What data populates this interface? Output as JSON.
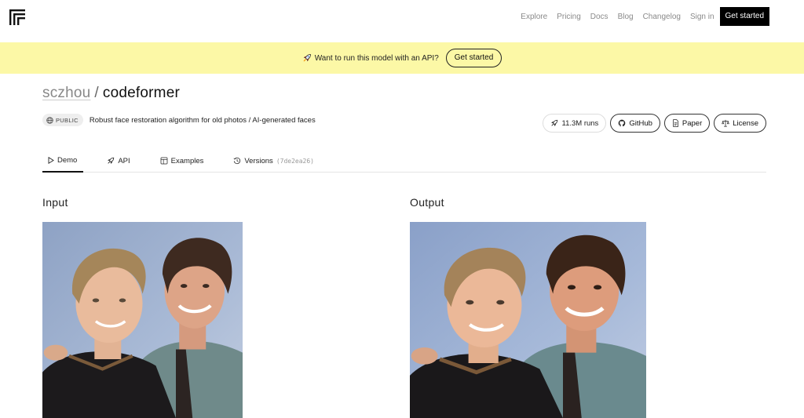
{
  "nav": {
    "logo_icon": "replicate-logo-icon",
    "links": [
      "Explore",
      "Pricing",
      "Docs",
      "Blog",
      "Changelog",
      "Sign in"
    ],
    "cta": "Get started"
  },
  "banner": {
    "icon": "rocket-icon",
    "text": "Want to run this model with an API?",
    "button": "Get started",
    "background": "#fcf8a6"
  },
  "model": {
    "owner": "sczhou",
    "separator": "/",
    "name": "codeformer",
    "visibility": "PUBLIC",
    "description": "Robust face restoration algorithm for old photos / AI-generated faces",
    "runs": "11.3M runs",
    "links": {
      "github": "GitHub",
      "paper": "Paper",
      "license": "License"
    }
  },
  "tabs": [
    {
      "label": "Demo",
      "icon": "play-icon",
      "active": true
    },
    {
      "label": "API",
      "icon": "rocket-icon",
      "active": false
    },
    {
      "label": "Examples",
      "icon": "gallery-icon",
      "active": false
    },
    {
      "label": "Versions",
      "icon": "history-icon",
      "active": false,
      "hash": "(7de2ea26)"
    }
  ],
  "panels": {
    "input_label": "Input",
    "output_label": "Output"
  }
}
